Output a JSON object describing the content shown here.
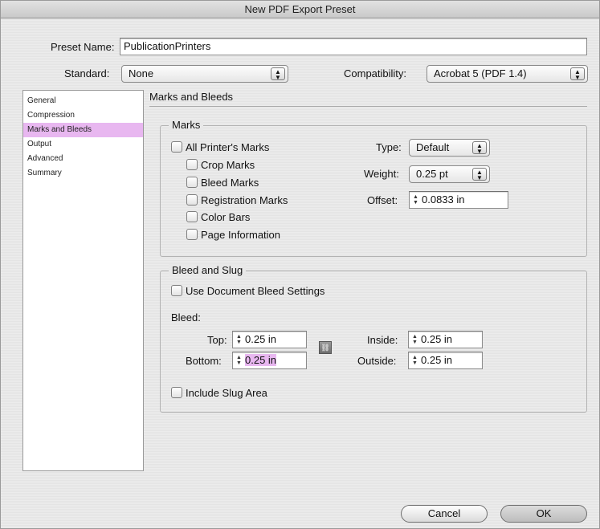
{
  "window": {
    "title": "New PDF Export Preset"
  },
  "preset": {
    "label": "Preset Name:",
    "value": "PublicationPrinters"
  },
  "standard": {
    "label": "Standard:",
    "value": "None"
  },
  "compatibility": {
    "label": "Compatibility:",
    "value": "Acrobat 5 (PDF 1.4)"
  },
  "sidebar": {
    "items": [
      {
        "label": "General",
        "selected": false
      },
      {
        "label": "Compression",
        "selected": false
      },
      {
        "label": "Marks and Bleeds",
        "selected": true
      },
      {
        "label": "Output",
        "selected": false
      },
      {
        "label": "Advanced",
        "selected": false
      },
      {
        "label": "Summary",
        "selected": false
      }
    ]
  },
  "panel": {
    "title": "Marks and Bleeds"
  },
  "marks": {
    "group_title": "Marks",
    "all": {
      "label": "All Printer's Marks",
      "checked": false
    },
    "options": [
      {
        "label": "Crop Marks",
        "checked": false
      },
      {
        "label": "Bleed Marks",
        "checked": false
      },
      {
        "label": "Registration Marks",
        "checked": false
      },
      {
        "label": "Color Bars",
        "checked": false
      },
      {
        "label": "Page Information",
        "checked": false
      }
    ],
    "type": {
      "label": "Type:",
      "value": "Default"
    },
    "weight": {
      "label": "Weight:",
      "value": "0.25 pt"
    },
    "offset": {
      "label": "Offset:",
      "value": "0.0833 in"
    }
  },
  "bleed": {
    "group_title": "Bleed and Slug",
    "use_doc": {
      "label": "Use Document Bleed Settings",
      "checked": false
    },
    "bleed_label": "Bleed:",
    "top": {
      "label": "Top:",
      "value": "0.25 in"
    },
    "bottom": {
      "label": "Bottom:",
      "value": "0.25 in"
    },
    "inside": {
      "label": "Inside:",
      "value": "0.25 in"
    },
    "outside": {
      "label": "Outside:",
      "value": "0.25 in"
    },
    "slug": {
      "label": "Include Slug Area",
      "checked": false
    }
  },
  "buttons": {
    "cancel": "Cancel",
    "ok": "OK"
  },
  "colors": {
    "selection": "#e8b7f0"
  }
}
